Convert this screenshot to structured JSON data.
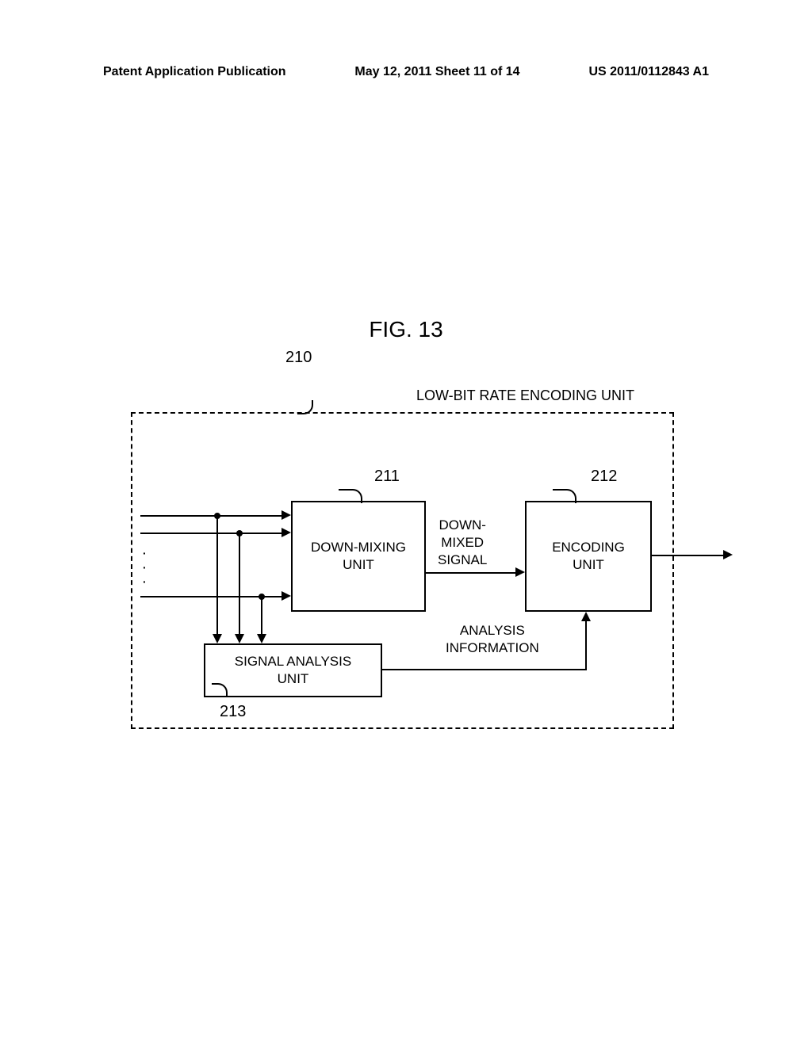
{
  "header": {
    "left": "Patent Application Publication",
    "center": "May 12, 2011  Sheet 11 of 14",
    "right": "US 2011/0112843 A1"
  },
  "figure_title": "FIG. 13",
  "diagram": {
    "container_title": "LOW-BIT RATE ENCODING UNIT",
    "refs": {
      "r210": "210",
      "r211": "211",
      "r212": "212",
      "r213": "213"
    },
    "boxes": {
      "downmixing": "DOWN-MIXING\nUNIT",
      "encoding": "ENCODING\nUNIT",
      "analysis": "SIGNAL ANALYSIS\nUNIT"
    },
    "labels": {
      "downmixed_signal": "DOWN-\nMIXED\nSIGNAL",
      "analysis_info": "ANALYSIS\nINFORMATION"
    }
  }
}
